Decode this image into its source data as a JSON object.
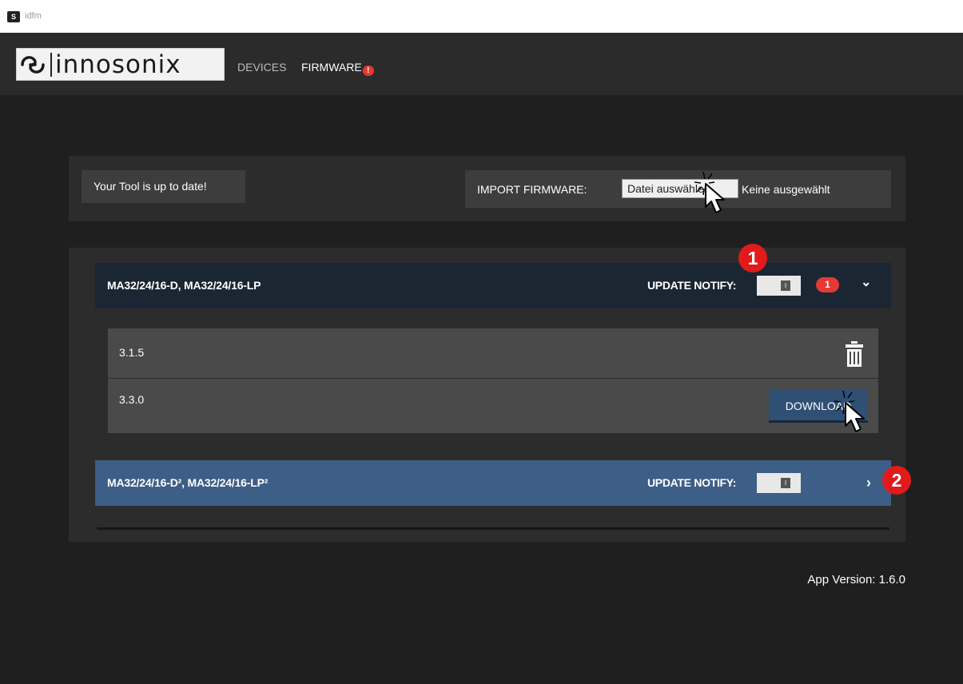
{
  "window": {
    "title": "idfm"
  },
  "nav": {
    "brand": "innosonix",
    "links": {
      "devices": "DEVICES",
      "firmware": "FIRMWARE"
    },
    "firmware_badge": "!"
  },
  "status": {
    "message": "Your Tool is up to date!"
  },
  "import": {
    "label": "IMPORT FIRMWARE:",
    "button": "Datei auswählen",
    "file_status": "Keine ausgewählt"
  },
  "groups": [
    {
      "name": "MA32/24/16-D, MA32/24/16-LP",
      "notify_label": "UPDATE NOTIFY:",
      "toggle_knob": "I",
      "count": "1",
      "expanded": true,
      "firmware": [
        {
          "version": "3.1.5",
          "action": "delete",
          "action_icon": "trash-icon"
        },
        {
          "version": "3.3.0",
          "action": "download",
          "action_label": "DOWNLOAD"
        }
      ]
    },
    {
      "name": "MA32/24/16-D², MA32/24/16-LP²",
      "notify_label": "UPDATE NOTIFY:",
      "toggle_knob": "I",
      "expanded": false
    }
  ],
  "footer": {
    "app_version": "App Version: 1.6.0"
  },
  "annotations": {
    "step1": "1",
    "step2": "2"
  },
  "colors": {
    "background": "#1f1f1f",
    "navbar": "#2b2b2b",
    "group_header_active": "#1b2633",
    "group_header_collapsed": "#3d5e86",
    "download_button": "#2f4f75",
    "badge": "#e53935"
  }
}
